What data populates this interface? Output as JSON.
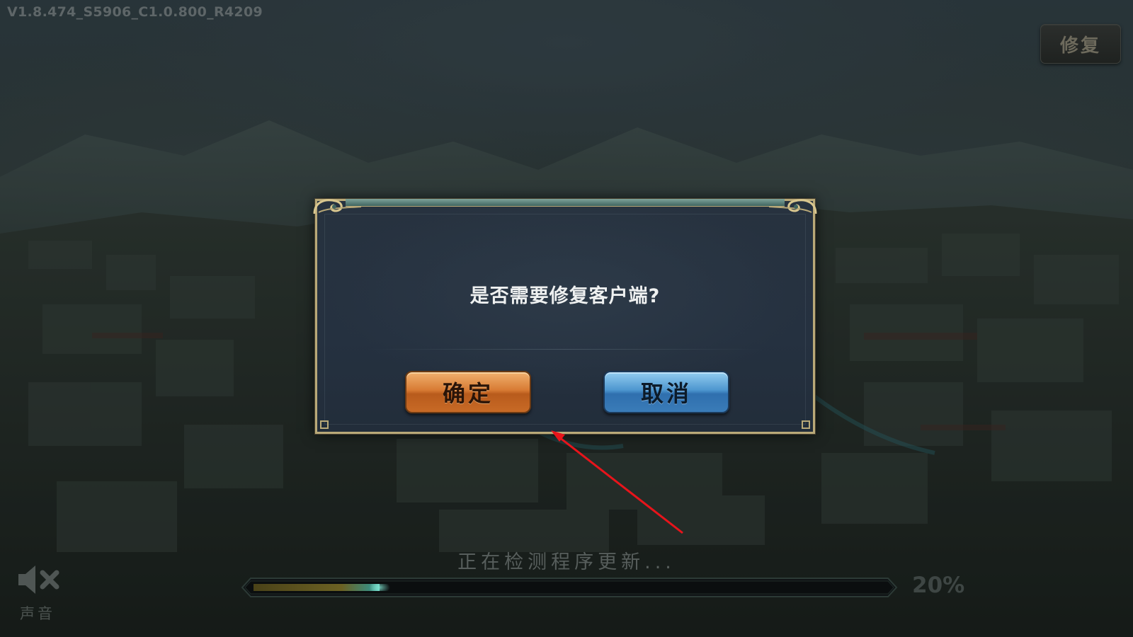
{
  "header": {
    "version_text": "V1.8.474_S5906_C1.0.800_R4209",
    "repair_button_label": "修复"
  },
  "dialog": {
    "message": "是否需要修复客户端?",
    "confirm_label": "确定",
    "cancel_label": "取消"
  },
  "loading": {
    "status_text": "正在检测程序更新...",
    "progress_percent_text": "20%",
    "progress_value": 0.2
  },
  "sound": {
    "label": "声音",
    "icon": "sound-muted-icon",
    "muted": true
  },
  "colors": {
    "confirm_button": "#d87b34",
    "cancel_button": "#4d96cf",
    "dialog_border": "#b9a978",
    "annotation_arrow": "#e8141b"
  }
}
